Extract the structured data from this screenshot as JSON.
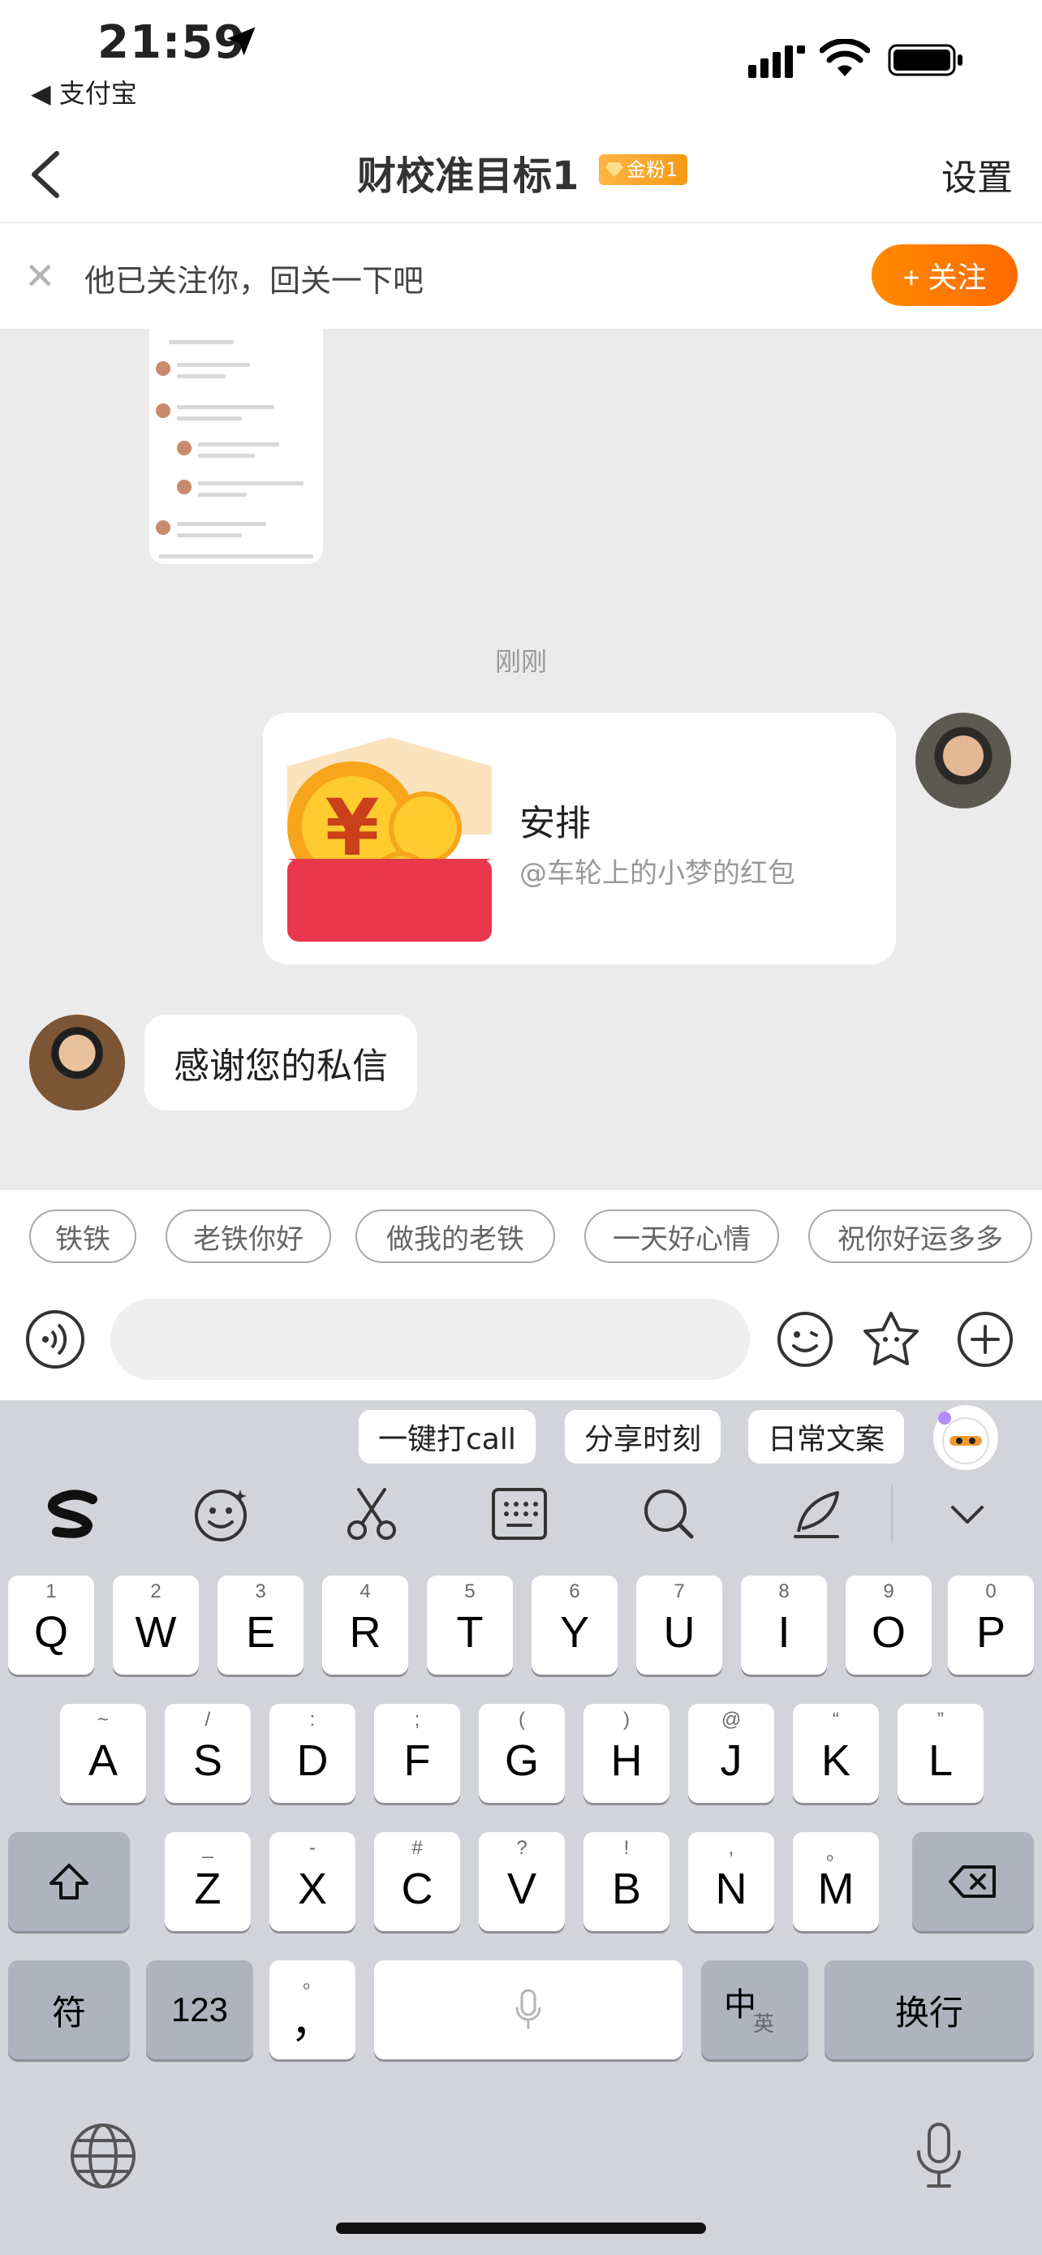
{
  "status_bar": {
    "time": "21:59",
    "back_app": "◀ 支付宝"
  },
  "nav": {
    "title": "财校准目标1",
    "badge": "金粉1",
    "settings": "设置"
  },
  "follow_banner": {
    "text": "他已关注你，回关一下吧",
    "button": "+ 关注"
  },
  "chat": {
    "timestamp": "刚刚",
    "red_packet": {
      "title": "安排",
      "subtitle": "@车轮上的小梦的红包"
    },
    "incoming": "感谢您的私信"
  },
  "quick_replies": [
    "铁铁",
    "老铁你好",
    "做我的老铁",
    "一天好心情",
    "祝你好运多多"
  ],
  "input": {
    "placeholder": ""
  },
  "keyboard": {
    "suggestions": [
      "一键打call",
      "分享时刻",
      "日常文案"
    ],
    "tools": [
      "sogou-logo-icon",
      "emoji-icon",
      "scissors-icon",
      "keyboard-icon",
      "search-icon",
      "pen-icon",
      "chevron-down-icon"
    ],
    "row1": [
      {
        "k": "Q",
        "s": "1"
      },
      {
        "k": "W",
        "s": "2"
      },
      {
        "k": "E",
        "s": "3"
      },
      {
        "k": "R",
        "s": "4"
      },
      {
        "k": "T",
        "s": "5"
      },
      {
        "k": "Y",
        "s": "6"
      },
      {
        "k": "U",
        "s": "7"
      },
      {
        "k": "I",
        "s": "8"
      },
      {
        "k": "O",
        "s": "9"
      },
      {
        "k": "P",
        "s": "0"
      }
    ],
    "row2": [
      {
        "k": "A",
        "s": "~"
      },
      {
        "k": "S",
        "s": "/"
      },
      {
        "k": "D",
        "s": ":"
      },
      {
        "k": "F",
        "s": ";"
      },
      {
        "k": "G",
        "s": "("
      },
      {
        "k": "H",
        "s": ")"
      },
      {
        "k": "J",
        "s": "@"
      },
      {
        "k": "K",
        "s": "“"
      },
      {
        "k": "L",
        "s": "”"
      }
    ],
    "row3": [
      {
        "k": "Z",
        "s": "_"
      },
      {
        "k": "X",
        "s": "-"
      },
      {
        "k": "C",
        "s": "#"
      },
      {
        "k": "V",
        "s": "?"
      },
      {
        "k": "B",
        "s": "!"
      },
      {
        "k": "N",
        "s": ","
      },
      {
        "k": "M",
        "s": "。"
      }
    ],
    "symbols": "符",
    "numbers": "123",
    "comma": "，",
    "comma_sup": "。",
    "lang_main": "中",
    "lang_sub": "英",
    "enter": "换行"
  }
}
